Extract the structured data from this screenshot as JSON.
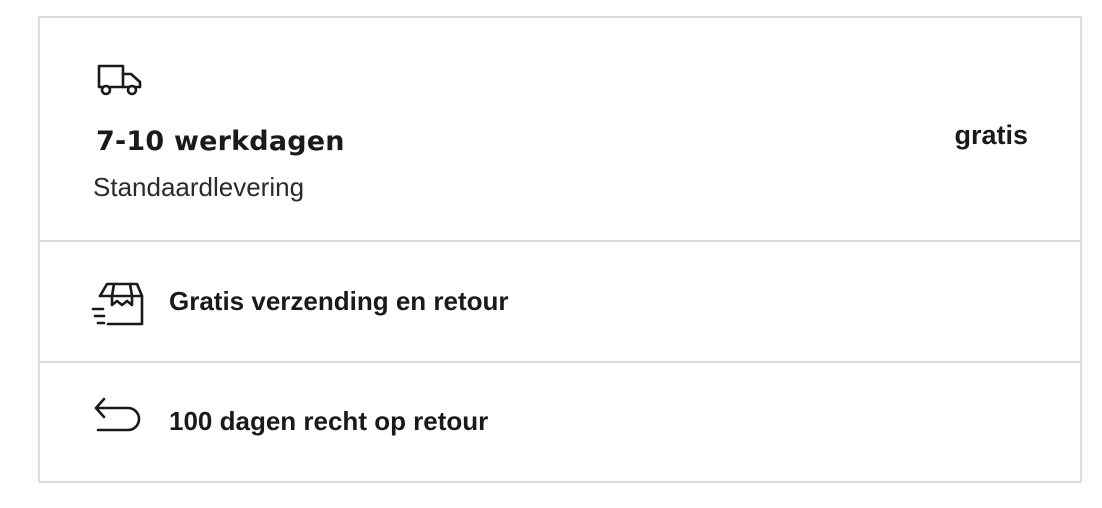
{
  "delivery": {
    "icon": "truck-icon",
    "time": "7-10 werkdagen",
    "method": "Standaardlevering",
    "price": "gratis"
  },
  "benefits": [
    {
      "icon": "package-shipping-icon",
      "label": "Gratis verzending en retour"
    },
    {
      "icon": "return-arrow-icon",
      "label": "100 dagen recht op retour"
    }
  ],
  "colors": {
    "border": "#dcdcdc",
    "text": "#1a1a1a",
    "background": "#ffffff"
  }
}
